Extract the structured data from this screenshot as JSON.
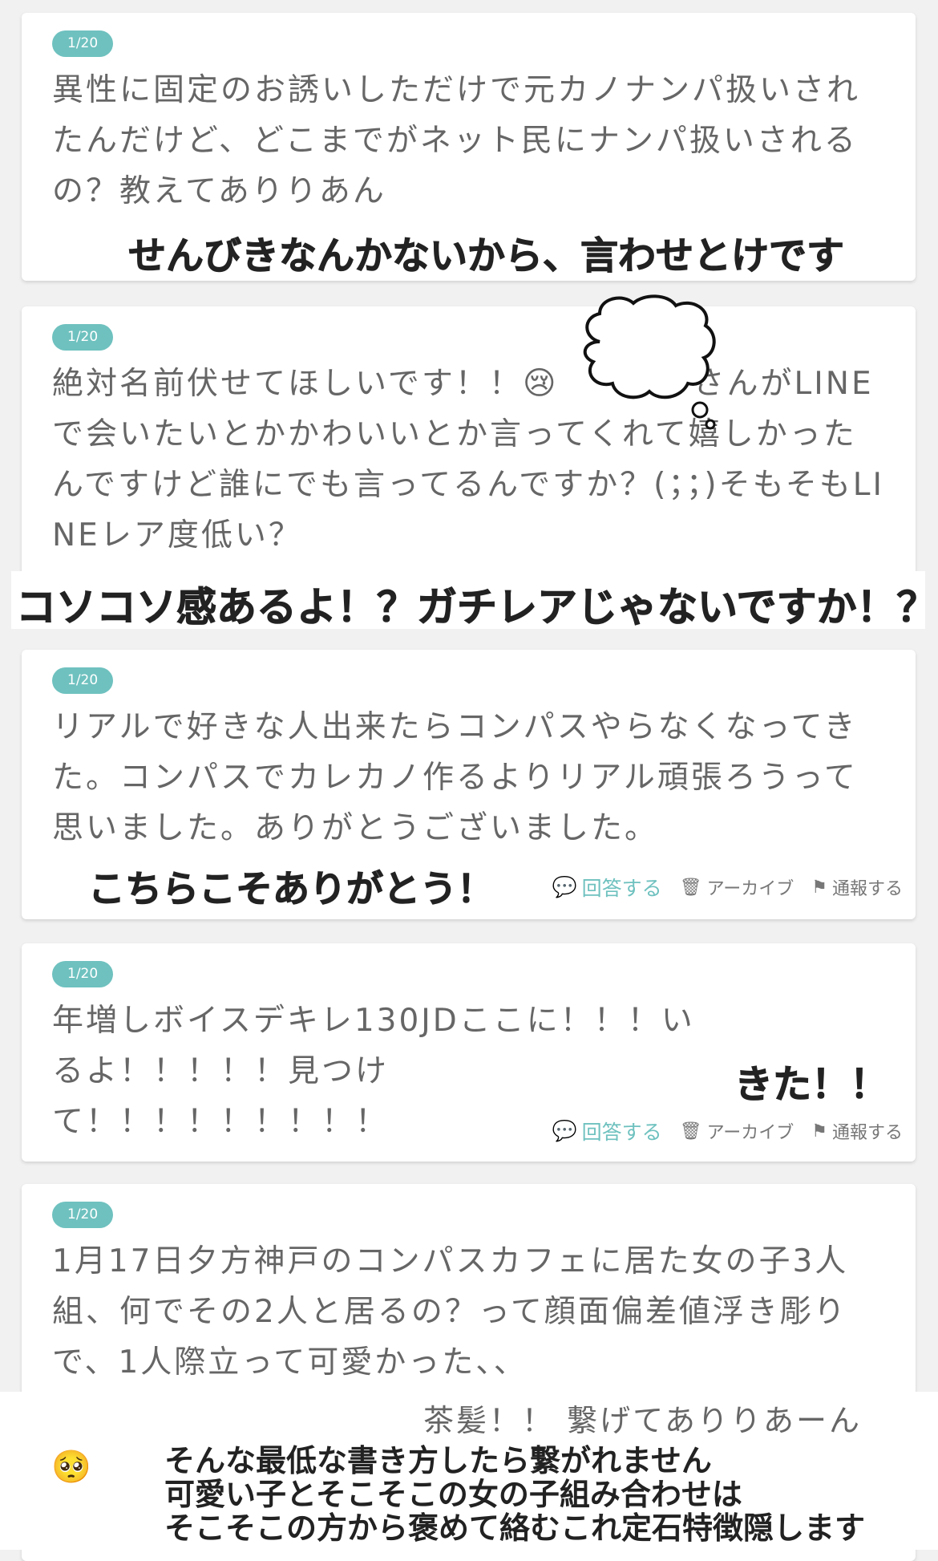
{
  "cards": [
    {
      "date": "1/20",
      "question": "異性に固定のお誘いしただけで元カノナンパ扱いされたんだけど、どこまでがネット民にナンパ扱いされるの？教えてありりあん",
      "answer": "せんびきなんかないから、言わせとけです"
    },
    {
      "date": "1/20",
      "question_before_emoji": "絶対名前伏せてほしいです！！",
      "emoji": "😢",
      "question_after_emoji": "　　　　さんがLINEで会いたいとかかわいいとか言ってくれて嬉しかったんですけど誰にでも言ってるんですか？(；；)そもそもLINEレア度低い？",
      "answer": "コソコソ感あるよ！？ガチレアじゃないですか！？"
    },
    {
      "date": "1/20",
      "question": "リアルで好きな人出来たらコンパスやらなくなってきた。コンパスでカレカノ作るよりリアル頑張ろうって思いました。ありがとうございました。",
      "answer": "こちらこそありがとう！"
    },
    {
      "date": "1/20",
      "question": "年増しボイスデキレ130JDここに！！！いるよ！！！！！見つけて！！！！！！！！！",
      "answer": "きた！！"
    },
    {
      "date": "1/20",
      "question": "1月17日夕方神戸のコンパスカフェに居た女の子3人組、何でその2人と居るの？って顔面偏差値浮き彫りで、1人際立って可愛かった、、",
      "question_tail": "茶髪！！ 繋げてありりあーん",
      "emoji": "🥺",
      "answer_lines": [
        "そんな最低な書き方したら繋がれません",
        "可愛い子とそこそこの女の子組み合わせは",
        "そこそこの方から褒めて絡むこれ定石特徴隠します"
      ]
    }
  ],
  "actions": {
    "reply": "回答する",
    "archive": "アーカイブ",
    "report": "通報する"
  },
  "colors": {
    "accent": "#6ec1bf",
    "background": "#f1f1f1",
    "text": "#666666"
  },
  "icons": [
    "chat-bubble-icon",
    "trash-icon",
    "flag-icon"
  ]
}
